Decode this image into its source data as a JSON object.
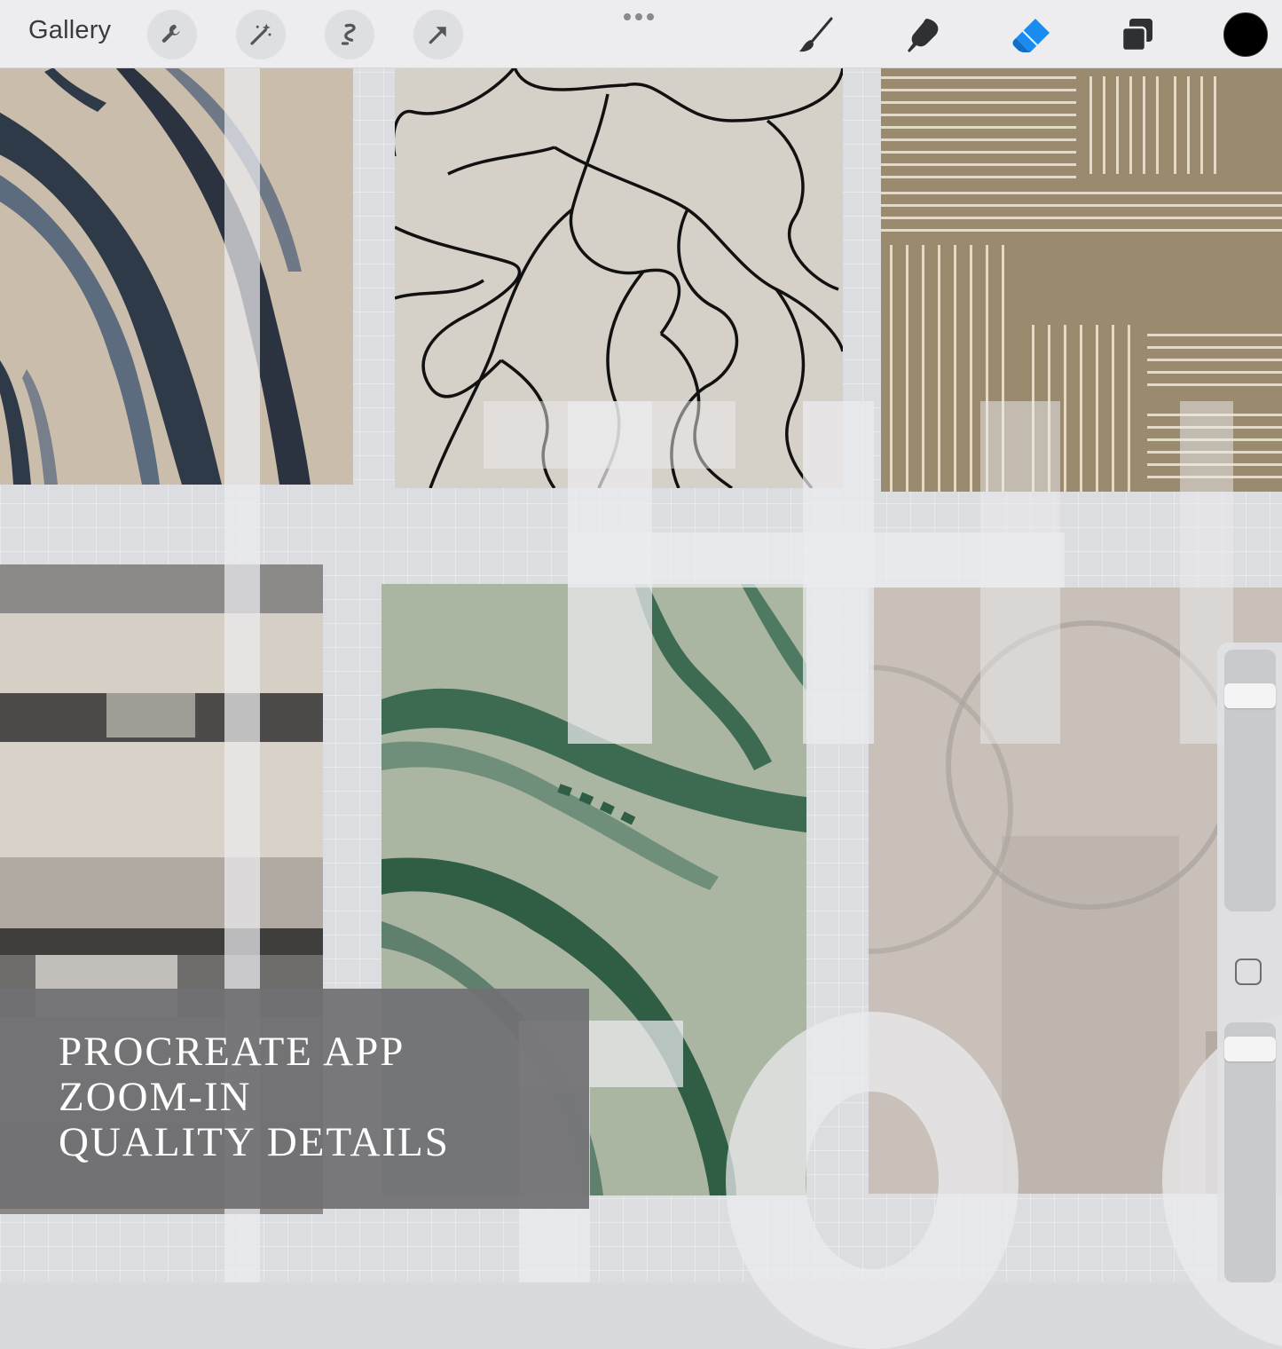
{
  "toolbar": {
    "gallery_label": "Gallery",
    "left_tools": [
      {
        "name": "wrench-icon"
      },
      {
        "name": "magic-wand-icon"
      },
      {
        "name": "selection-icon"
      },
      {
        "name": "transform-arrow-icon"
      }
    ],
    "right_tools": [
      {
        "name": "brush-icon"
      },
      {
        "name": "smudge-icon"
      },
      {
        "name": "eraser-icon",
        "active": true
      },
      {
        "name": "layers-icon"
      }
    ],
    "active_color": "#000000",
    "accent_color": "#1a8cf0"
  },
  "caption": {
    "line1": "PROCREATE APP",
    "line2": "ZOOM-IN",
    "line3": "QUALITY DETAILS"
  },
  "sidebar": {
    "brush_size_level": 0.15,
    "opacity_level": 0.1
  }
}
